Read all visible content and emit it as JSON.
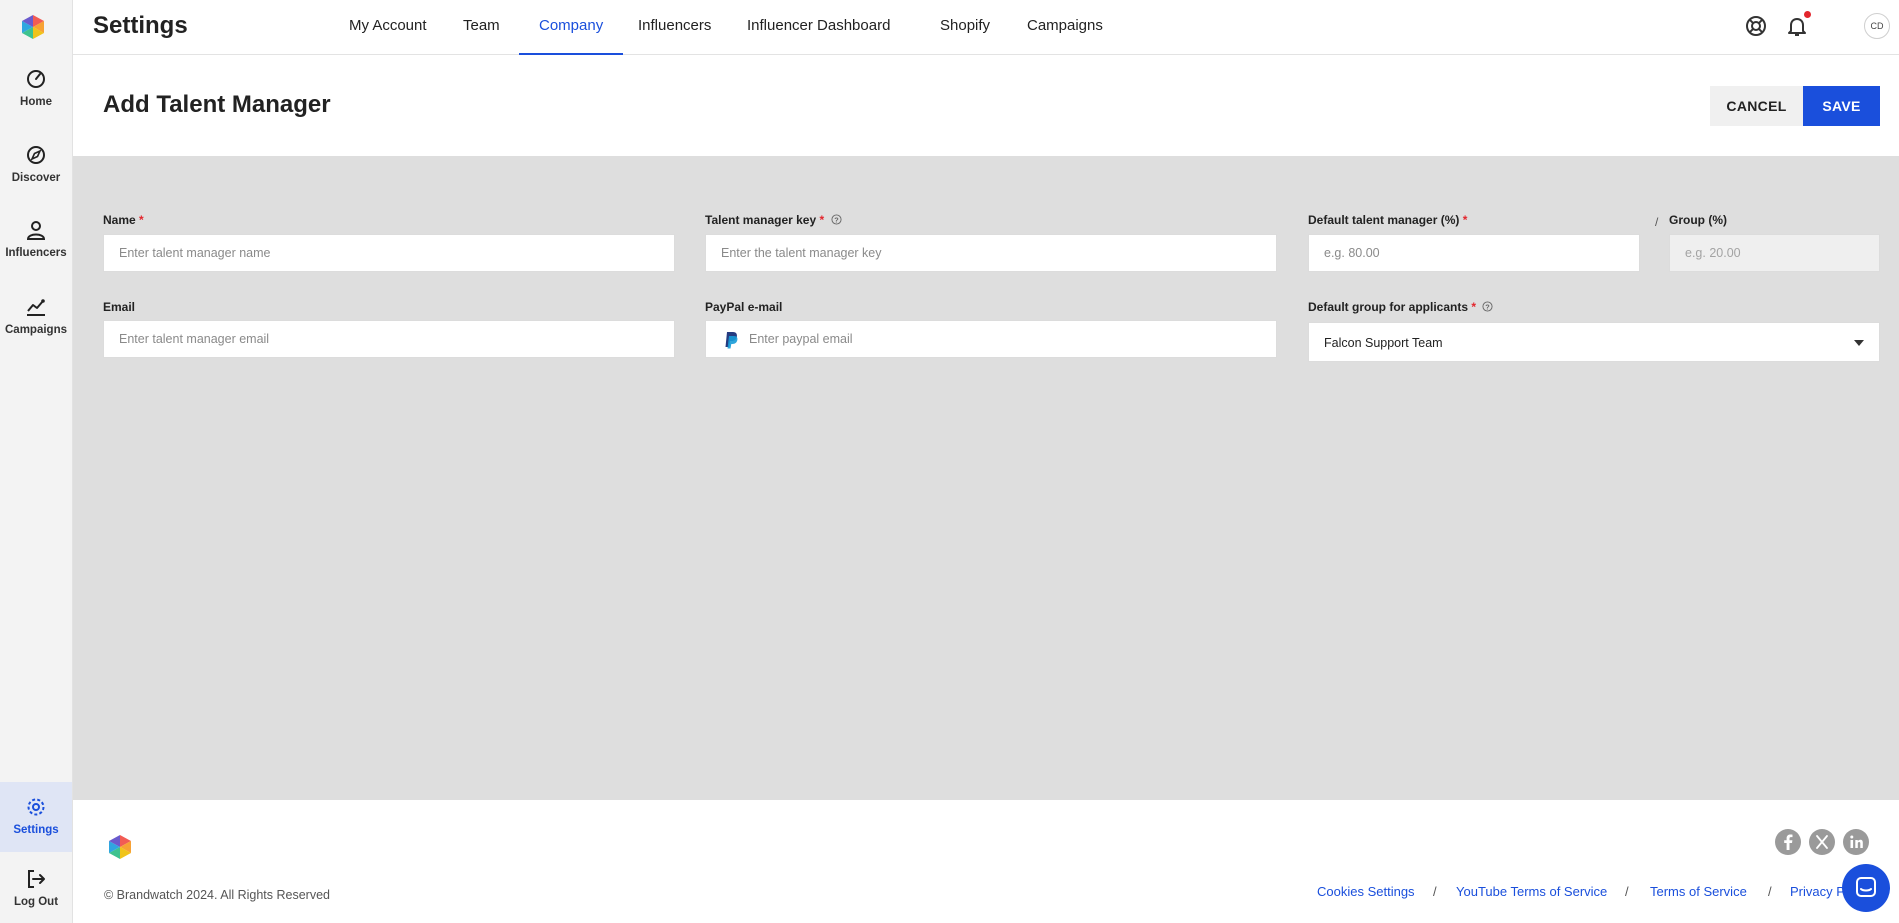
{
  "sidebar": {
    "items": [
      {
        "label": "Home"
      },
      {
        "label": "Discover"
      },
      {
        "label": "Influencers"
      },
      {
        "label": "Campaigns"
      },
      {
        "label": "Settings"
      },
      {
        "label": "Log Out"
      }
    ],
    "active": "Settings"
  },
  "header": {
    "title": "Settings",
    "tabs": [
      {
        "label": "My Account"
      },
      {
        "label": "Team"
      },
      {
        "label": "Company"
      },
      {
        "label": "Influencers"
      },
      {
        "label": "Influencer Dashboard"
      },
      {
        "label": "Shopify"
      },
      {
        "label": "Campaigns"
      }
    ],
    "active_tab": "Company",
    "avatar_initials": "CD",
    "icons": [
      "help-lifebuoy-icon",
      "bell-icon"
    ]
  },
  "page": {
    "title": "Add Talent Manager",
    "cancel_label": "CANCEL",
    "save_label": "SAVE"
  },
  "form": {
    "name": {
      "label": "Name",
      "required": "*",
      "placeholder": "Enter talent manager name",
      "value": ""
    },
    "key": {
      "label": "Talent manager key",
      "required": "*",
      "placeholder": "Enter the talent manager key",
      "value": ""
    },
    "default_pct": {
      "label": "Default talent manager (%)",
      "required": "*",
      "placeholder": "e.g. 80.00",
      "value": ""
    },
    "separator": "/",
    "group_pct": {
      "label": "Group (%)",
      "placeholder": "e.g. 20.00",
      "value": ""
    },
    "email": {
      "label": "Email",
      "placeholder": "Enter talent manager email",
      "value": ""
    },
    "paypal": {
      "label": "PayPal e-mail",
      "placeholder": "Enter paypal email",
      "value": ""
    },
    "default_group": {
      "label": "Default group for applicants",
      "required": "*",
      "value": "Falcon Support Team"
    }
  },
  "footer": {
    "copyright": "© Brandwatch 2024. All Rights Reserved",
    "links": [
      {
        "label": "Cookies Settings"
      },
      {
        "label": "YouTube Terms of Service"
      },
      {
        "label": "Terms of Service"
      },
      {
        "label": "Privacy P"
      }
    ],
    "separator": "/",
    "social": [
      "facebook-icon",
      "x-twitter-icon",
      "linkedin-icon"
    ]
  },
  "colors": {
    "accent": "#1a4fdc",
    "required": "#e3262d",
    "form_background": "#dedede",
    "sidebar_background": "#f3f3f3"
  }
}
